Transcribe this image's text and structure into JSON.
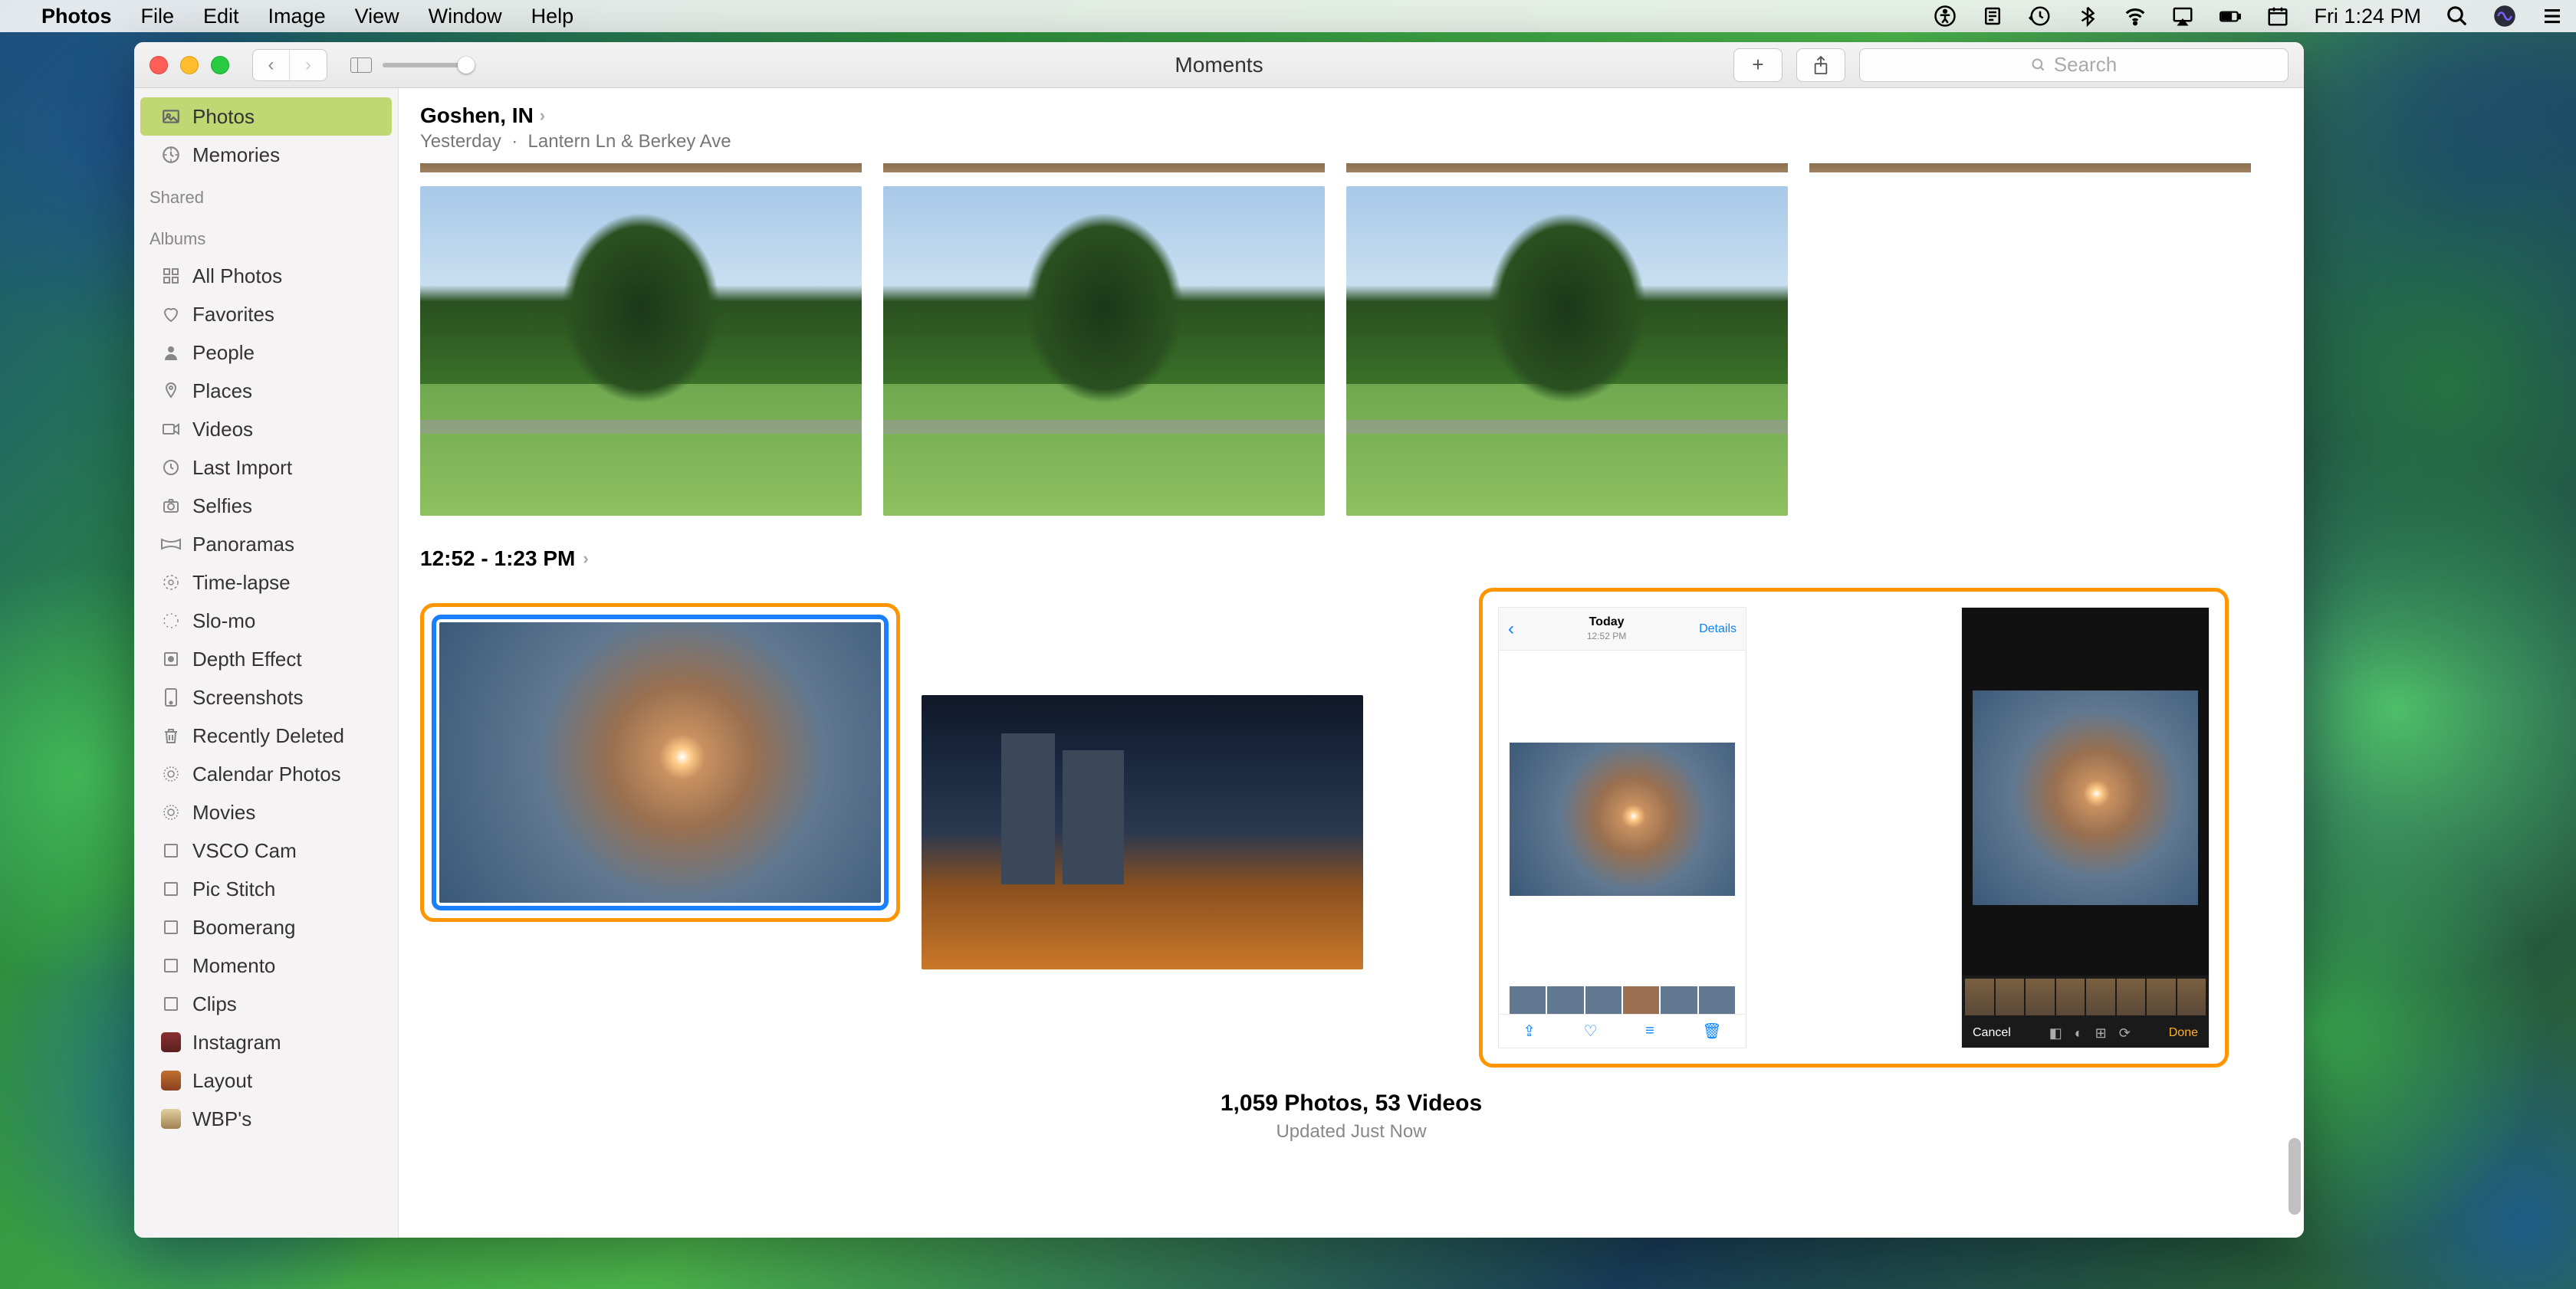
{
  "menubar": {
    "app": "Photos",
    "items": [
      "File",
      "Edit",
      "Image",
      "View",
      "Window",
      "Help"
    ],
    "clock": "Fri 1:24 PM"
  },
  "window": {
    "title": "Moments",
    "search_placeholder": "Search"
  },
  "sidebar": {
    "top": [
      {
        "icon": "photos",
        "label": "Photos"
      },
      {
        "icon": "memories",
        "label": "Memories"
      }
    ],
    "section_shared": "Shared",
    "section_albums": "Albums",
    "albums": [
      {
        "icon": "all",
        "label": "All Photos"
      },
      {
        "icon": "heart",
        "label": "Favorites"
      },
      {
        "icon": "person",
        "label": "People"
      },
      {
        "icon": "pin",
        "label": "Places"
      },
      {
        "icon": "video",
        "label": "Videos"
      },
      {
        "icon": "clock",
        "label": "Last Import"
      },
      {
        "icon": "camera",
        "label": "Selfies"
      },
      {
        "icon": "pano",
        "label": "Panoramas"
      },
      {
        "icon": "timelapse",
        "label": "Time-lapse"
      },
      {
        "icon": "slomo",
        "label": "Slo-mo"
      },
      {
        "icon": "depth",
        "label": "Depth Effect"
      },
      {
        "icon": "screen",
        "label": "Screenshots"
      },
      {
        "icon": "trash",
        "label": "Recently Deleted"
      },
      {
        "icon": "gear",
        "label": "Calendar Photos"
      },
      {
        "icon": "gear",
        "label": "Movies"
      },
      {
        "icon": "folder",
        "label": "VSCO Cam"
      },
      {
        "icon": "folder",
        "label": "Pic Stitch"
      },
      {
        "icon": "folder",
        "label": "Boomerang"
      },
      {
        "icon": "folder",
        "label": "Momento"
      },
      {
        "icon": "folder",
        "label": "Clips"
      },
      {
        "icon": "color1",
        "label": "Instagram"
      },
      {
        "icon": "color2",
        "label": "Layout"
      },
      {
        "icon": "color3",
        "label": "WBP's"
      }
    ]
  },
  "moment": {
    "title": "Goshen, IN",
    "subtitle_date": "Yesterday",
    "subtitle_loc": "Lantern Ln & Berkey Ave"
  },
  "section2": {
    "title": "12:52 - 1:23 PM"
  },
  "screenshot_photo": {
    "today": "Today",
    "time": "12:52 PM",
    "details": "Details"
  },
  "screenshot_edit": {
    "cancel": "Cancel",
    "done": "Done"
  },
  "footer": {
    "count": "1,059 Photos, 53 Videos",
    "updated": "Updated Just Now"
  }
}
